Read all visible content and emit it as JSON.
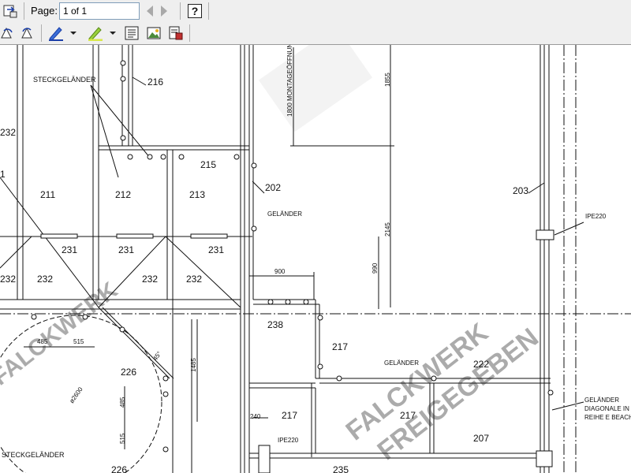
{
  "toolbar": {
    "page_label": "Page:",
    "page_value": "1 of 1"
  },
  "drawing": {
    "labels": {
      "steckgelaender_top": "STECKGELÄNDER",
      "steckgelaender_bottom": "STECKGELÄNDER",
      "montage": "1800 MONTAGEÖFFNUN",
      "gelaender_202": "GELÄNDER",
      "gelaender_222": "GELÄNDER",
      "gelaender_right_1": "GELÄNDER",
      "gelaender_right_2": "DIAGONALE IN V",
      "gelaender_right_3": "REIHE E BEACHT",
      "ipe_top": "IPE220",
      "ipe_bottom": "IPE220",
      "angle": "45°",
      "diameter": "ø2600"
    },
    "dimensions": {
      "d1855": "1855",
      "d2145": "2145",
      "d990": "990",
      "d900": "900",
      "d485h": "485",
      "d515h": "515",
      "d1485": "1485",
      "d485v": "485",
      "d515v": "515",
      "d240": "240"
    },
    "part_numbers": {
      "p216": "216",
      "p232a": "232",
      "p232b": "232",
      "p232c": "232",
      "p232d": "232",
      "p232e": "232",
      "p211": "211",
      "p212": "212",
      "p213": "213",
      "p215": "215",
      "p202": "202",
      "p203": "203",
      "p231a": "231",
      "p231b": "231",
      "p231c": "231",
      "p238": "238",
      "p217a": "217",
      "p217b": "217",
      "p217c": "217",
      "p222": "222",
      "p226a": "226",
      "p226b": "226",
      "p207": "207",
      "p235": "235",
      "p21x": "1"
    },
    "watermark": [
      "FALCKWERK",
      "FREIGEGEBEN"
    ]
  }
}
